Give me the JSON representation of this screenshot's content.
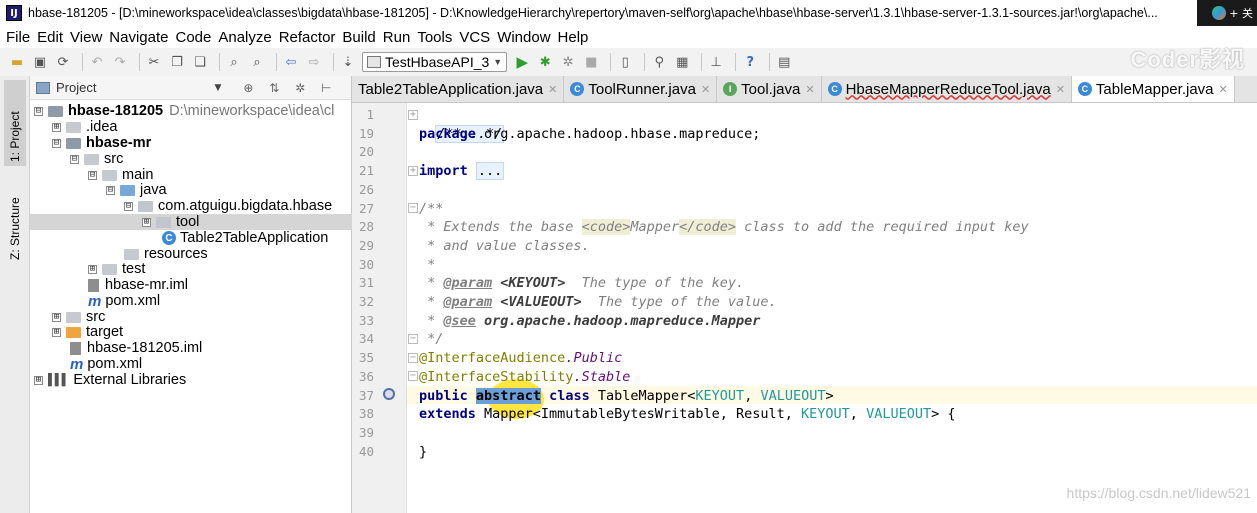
{
  "window": {
    "title": "hbase-181205 - [D:\\mineworkspace\\idea\\classes\\bigdata\\hbase-181205] - D:\\KnowledgeHierarchy\\repertory\\maven-self\\org\\apache\\hbase\\hbase-server\\1.3.1\\hbase-server-1.3.1-sources.jar!\\org\\apache\\...",
    "app_icon": "IJ",
    "corner_text": "+ 关"
  },
  "menu": [
    "File",
    "Edit",
    "View",
    "Navigate",
    "Code",
    "Analyze",
    "Refactor",
    "Build",
    "Run",
    "Tools",
    "VCS",
    "Window",
    "Help"
  ],
  "toolbar": {
    "run_config": "TestHbaseAPI_3",
    "watermark": "Coder影视"
  },
  "left_strip": {
    "project": "1: Project",
    "structure": "Z: Structure"
  },
  "project_panel": {
    "title": "Project",
    "tree": [
      {
        "label": "hbase-181205",
        "extra": "D:\\mineworkspace\\idea\\cl",
        "toggle": "⊟",
        "icon": "module"
      },
      {
        "label": ".idea",
        "toggle": "⊞",
        "icon": "folder"
      },
      {
        "label": "hbase-mr",
        "toggle": "⊟",
        "icon": "module"
      },
      {
        "label": "src",
        "toggle": "⊟",
        "icon": "folder"
      },
      {
        "label": "main",
        "toggle": "⊟",
        "icon": "folder"
      },
      {
        "label": "java",
        "toggle": "⊟",
        "icon": "blue"
      },
      {
        "label": "com.atguigu.bigdata.hbase",
        "toggle": "⊟",
        "icon": "pkg"
      },
      {
        "label": "tool",
        "toggle": "⊞",
        "icon": "pkg"
      },
      {
        "label": "Table2TableApplication",
        "icon": "class"
      },
      {
        "label": "resources",
        "icon": "folder"
      },
      {
        "label": "test",
        "toggle": "⊞",
        "icon": "folder"
      },
      {
        "label": "hbase-mr.iml",
        "icon": "iml"
      },
      {
        "label": "pom.xml",
        "icon": "m"
      },
      {
        "label": "src",
        "toggle": "⊞",
        "icon": "folder"
      },
      {
        "label": "target",
        "toggle": "⊞",
        "icon": "orange"
      },
      {
        "label": "hbase-181205.iml",
        "icon": "iml"
      },
      {
        "label": "pom.xml",
        "icon": "m"
      },
      {
        "label": "External Libraries",
        "toggle": "⊞",
        "icon": "libs"
      }
    ]
  },
  "tabs": [
    {
      "label": "Table2TableApplication.java",
      "icon": "",
      "active": false
    },
    {
      "label": "ToolRunner.java",
      "icon": "C",
      "active": false
    },
    {
      "label": "Tool.java",
      "icon": "I",
      "active": false
    },
    {
      "label": "HbaseMapperReduceTool.java",
      "icon": "C",
      "active": false
    },
    {
      "label": "TableMapper.java",
      "icon": "C",
      "active": true
    }
  ],
  "editor": {
    "line_numbers": [
      "1",
      "19",
      "20",
      "21",
      "26",
      "27",
      "28",
      "29",
      "30",
      "31",
      "32",
      "33",
      "34",
      "35",
      "36",
      "37",
      "38",
      "39",
      "40"
    ],
    "code": {
      "l1": "/**...*/",
      "l19_kw": "package",
      "l19_rest": " org.apache.hadoop.hbase.mapreduce;",
      "l21_kw": "import",
      "l21_fold": "...",
      "l27": "/**",
      "l28_a": " * Extends the base ",
      "l28_tag1": "<code>",
      "l28_b": "Mapper",
      "l28_tag2": "</code>",
      "l28_c": " class to add the required input key",
      "l29": " * and value classes.",
      "l30": " *",
      "l31_a": " * ",
      "l31_tag": "@param",
      "l31_p": " <KEYOUT>",
      "l31_b": "  The type of the key.",
      "l32_a": " * ",
      "l32_tag": "@param",
      "l32_p": " <VALUEOUT>",
      "l32_b": "  The type of the value.",
      "l33_a": " * ",
      "l33_tag": "@see",
      "l33_p": " org.apache.hadoop.mapreduce.Mapper",
      "l34": " */",
      "l35_ann": "@InterfaceAudience",
      "l35_field": ".Public",
      "l36_ann": "@InterfaceStability",
      "l36_field": ".Stable",
      "l37_kw1": "public",
      "l37_sel": "abstract",
      "l37_kw2": "class",
      "l37_name": " TableMapper<",
      "l37_t1": "KEYOUT",
      "l37_sep": ", ",
      "l37_t2": "VALUEOUT",
      "l37_end": ">",
      "l38_kw": "extends",
      "l38_a": " Mapper<ImmutableBytesWritable, Result, ",
      "l38_t1": "KEYOUT",
      "l38_sep": ", ",
      "l38_t2": "VALUEOUT",
      "l38_end": "> {",
      "l40": "}"
    }
  },
  "watermark_bottom": "https://blog.csdn.net/lidew521"
}
